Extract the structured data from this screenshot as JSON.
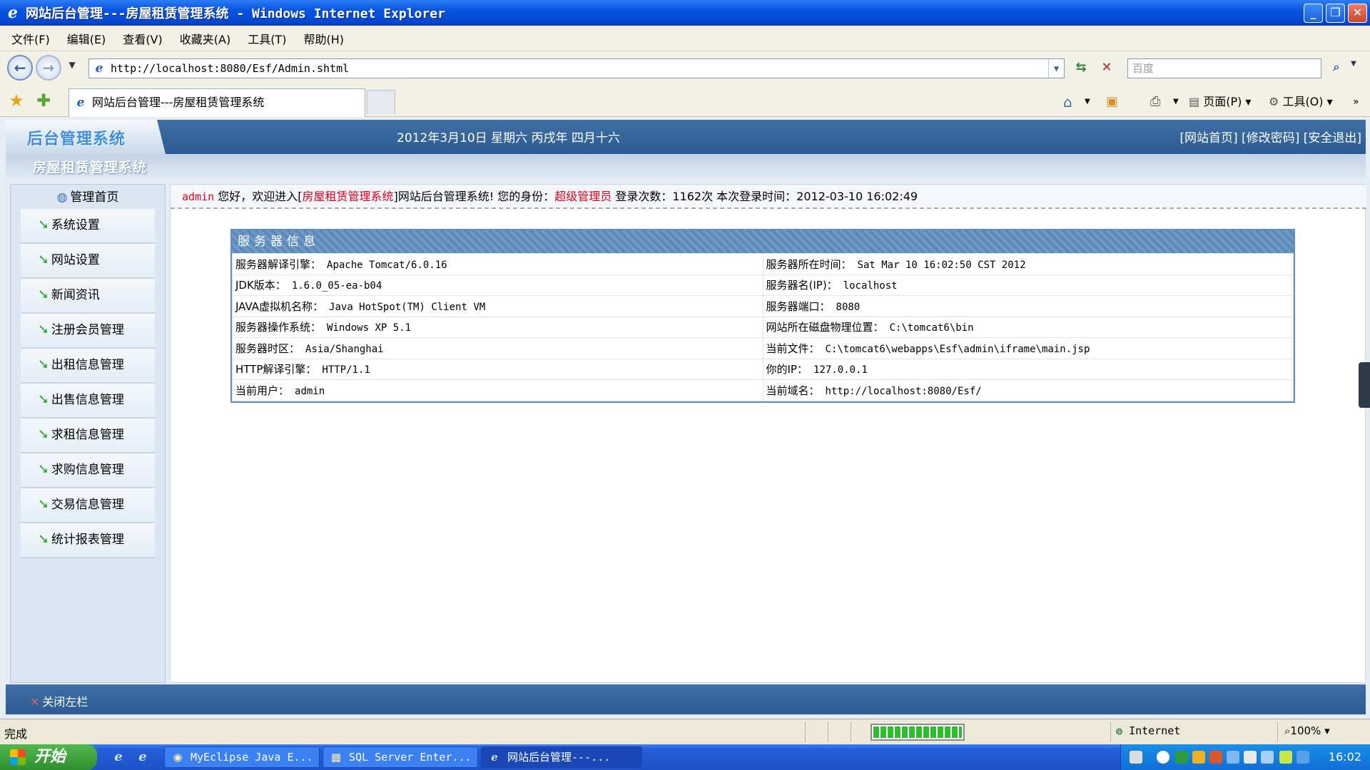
{
  "window": {
    "title": "网站后台管理---房屋租赁管理系统 - Windows Internet Explorer",
    "buttons": {
      "minimize": "_",
      "restore": "❐",
      "close": "✕"
    }
  },
  "menubar": [
    "文件(F)",
    "编辑(E)",
    "查看(V)",
    "收藏夹(A)",
    "工具(T)",
    "帮助(H)"
  ],
  "address": {
    "url": "http://localhost:8080/Esf/Admin.shtml",
    "search_placeholder": "百度"
  },
  "tab": {
    "title": "网站后台管理---房屋租赁管理系统"
  },
  "commandbar": {
    "page": "页面(P)",
    "tools": "工具(O)"
  },
  "header": {
    "logo": "后台管理系统",
    "date": "2012年3月10日 星期六 丙戌年 四月十六",
    "links": "[网站首页] [修改密码] [安全退出]",
    "system_name": "房屋租赁管理系统"
  },
  "sidebar": {
    "home": "管理首页",
    "items": [
      "系统设置",
      "网站设置",
      "新闻资讯",
      "注册会员管理",
      "出租信息管理",
      "出售信息管理",
      "求租信息管理",
      "求购信息管理",
      "交易信息管理",
      "统计报表管理"
    ]
  },
  "welcome": {
    "user": "admin",
    "part1": " 您好，欢迎进入[",
    "system": "房屋租赁管理系统",
    "part2": "]网站后台管理系统! 您的身份：",
    "role": "超级管理员",
    "part3": " 登录次数：1162次 本次登录时间：2012-03-10 16:02:49"
  },
  "server_info": {
    "title": "服务器信息",
    "rows": [
      [
        {
          "label": "服务器解译引擎：",
          "value": "Apache Tomcat/6.0.16"
        },
        {
          "label": "服务器所在时间：",
          "value": "Sat Mar 10 16:02:50 CST 2012"
        }
      ],
      [
        {
          "label": "JDK版本：",
          "value": "1.6.0_05-ea-b04"
        },
        {
          "label": "服务器名(IP)：",
          "value": "localhost"
        }
      ],
      [
        {
          "label": "JAVA虚拟机名称：",
          "value": "Java HotSpot(TM) Client VM"
        },
        {
          "label": "服务器端口：",
          "value": "8080"
        }
      ],
      [
        {
          "label": "服务器操作系统：",
          "value": "Windows XP 5.1"
        },
        {
          "label": "网站所在磁盘物理位置：",
          "value": "C:\\tomcat6\\bin"
        }
      ],
      [
        {
          "label": "服务器时区：",
          "value": "Asia/Shanghai"
        },
        {
          "label": "当前文件：",
          "value": "C:\\tomcat6\\webapps\\Esf\\admin\\iframe\\main.jsp"
        }
      ],
      [
        {
          "label": "HTTP解译引擎：",
          "value": "HTTP/1.1"
        },
        {
          "label": "你的IP：",
          "value": "127.0.0.1"
        }
      ],
      [
        {
          "label": "当前用户：",
          "value": "admin"
        },
        {
          "label": "当前域名：",
          "value": "http://localhost:8080/Esf/"
        }
      ]
    ]
  },
  "footer": {
    "close_left": "关闭左栏"
  },
  "statusbar": {
    "status": "完成",
    "zone": "Internet",
    "zoom": "100%",
    "progress": 1.0
  },
  "taskbar": {
    "start": "开始",
    "tasks": [
      "MyEclipse Java E...",
      "SQL Server Enter...",
      "网站后台管理---..."
    ],
    "clock": "16:02"
  },
  "colors": {
    "accent_red": "#e0001a",
    "header_blue": "#2c5b91",
    "menu_arrow_green": "#2da82d"
  }
}
